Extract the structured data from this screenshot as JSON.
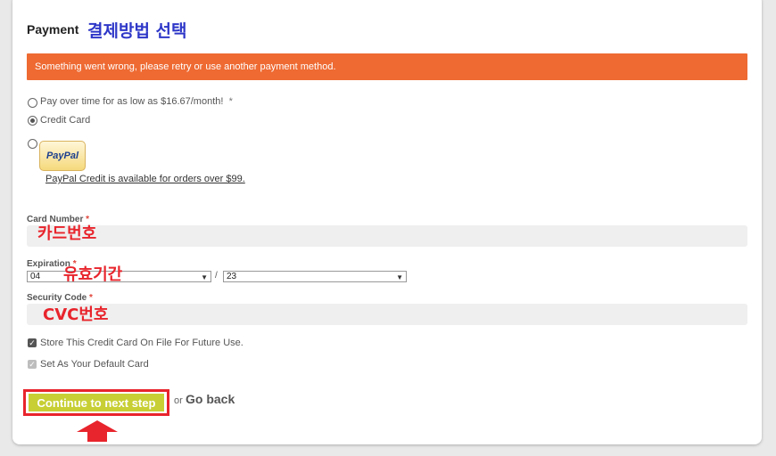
{
  "header": {
    "title": "Payment",
    "annotation": "결제방법 선택"
  },
  "alert": {
    "message": "Something went wrong, please retry or use another payment method."
  },
  "payment_options": {
    "pay_over_time": "Pay over time for as low as $16.67/month!",
    "pay_over_time_mark": "*",
    "credit_card": "Credit Card",
    "paypal_logo": "PayPal",
    "paypal_note": "PayPal Credit is available for orders over $99."
  },
  "form": {
    "card_number_label": "Card Number",
    "card_number_annotation": "카드번호",
    "expiration_label": "Expiration",
    "expiration_annotation": "유효기간",
    "exp_month": "04",
    "exp_separator": "/",
    "exp_year": "23",
    "security_code_label": "Security Code",
    "security_code_annotation": "CVC번호",
    "required_mark": "*"
  },
  "checkboxes": {
    "store_card": "Store This Credit Card On File For Future Use.",
    "default_card": "Set As Your Default Card",
    "check_glyph": "✓"
  },
  "actions": {
    "continue_label": "Continue to next step",
    "or_text": "or",
    "go_back": "Go back"
  },
  "colors": {
    "alert": "#ee6a32",
    "continue_button": "#c7cf35",
    "annotation_red": "#e8242c",
    "annotation_blue": "#2e37c8"
  },
  "icons": {
    "arrow": "arrow-up-icon"
  }
}
